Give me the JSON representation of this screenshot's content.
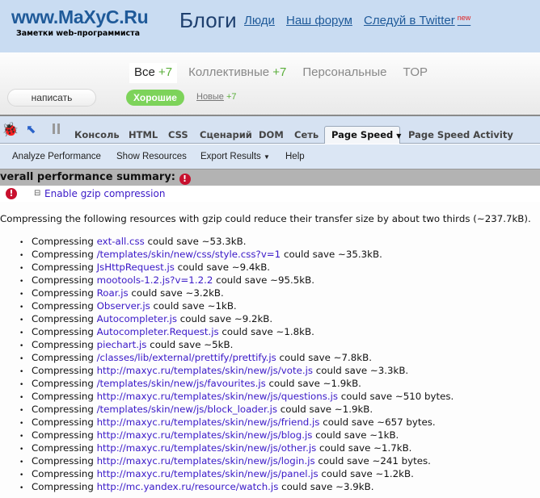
{
  "site": {
    "logo": "www.MaXyC.Ru",
    "tagline": "Заметки web-программиста",
    "section": "Блоги",
    "nav": [
      {
        "label": "Люди"
      },
      {
        "label": "Наш форум"
      },
      {
        "label": "Следуй в Twitter",
        "badge": "new"
      }
    ]
  },
  "tabs": [
    {
      "label": "Все",
      "count": "+7"
    },
    {
      "label": "Коллективные",
      "count": "+7"
    },
    {
      "label": "Персональные",
      "count": ""
    },
    {
      "label": "TOP",
      "count": ""
    }
  ],
  "write_button": "написать",
  "filters": {
    "good": "Хорошие",
    "new": "Новые",
    "new_count": "+7"
  },
  "firebug": {
    "tabs": [
      "Консоль",
      "HTML",
      "CSS",
      "Сценарий",
      "DOM",
      "Сеть",
      "Page Speed",
      "Page Speed Activity"
    ],
    "active_tab": "Page Speed",
    "toolbar": [
      "Analyze Performance",
      "Show Resources",
      "Export Results",
      "Help"
    ]
  },
  "summary": "verall performance summary:",
  "rule": "Enable gzip compression",
  "description": "Compressing the following resources with gzip could reduce their transfer size by about two thirds (~237.7kB).",
  "items": [
    {
      "pre": "Compressing ",
      "link": "ext-all.css",
      "post": " could save ~53.3kB."
    },
    {
      "pre": "Compressing ",
      "link": "/templates/skin/new/css/style.css?v=1",
      "post": " could save ~35.3kB."
    },
    {
      "pre": "Compressing ",
      "link": "JsHttpRequest.js",
      "post": " could save ~9.4kB."
    },
    {
      "pre": "Compressing ",
      "link": "mootools-1.2.js?v=1.2.2",
      "post": " could save ~95.5kB."
    },
    {
      "pre": "Compressing ",
      "link": "Roar.js",
      "post": " could save ~3.2kB."
    },
    {
      "pre": "Compressing ",
      "link": "Observer.js",
      "post": " could save ~1kB."
    },
    {
      "pre": "Compressing ",
      "link": "Autocompleter.js",
      "post": " could save ~9.2kB."
    },
    {
      "pre": "Compressing ",
      "link": "Autocompleter.Request.js",
      "post": " could save ~1.8kB."
    },
    {
      "pre": "Compressing ",
      "link": "piechart.js",
      "post": " could save ~5kB."
    },
    {
      "pre": "Compressing ",
      "link": "/classes/lib/external/prettify/prettify.js",
      "post": " could save ~7.8kB."
    },
    {
      "pre": "Compressing ",
      "link": "http://maxyc.ru/templates/skin/new/js/vote.js",
      "post": " could save ~3.3kB."
    },
    {
      "pre": "Compressing ",
      "link": "/templates/skin/new/js/favourites.js",
      "post": " could save ~1.9kB."
    },
    {
      "pre": "Compressing ",
      "link": "http://maxyc.ru/templates/skin/new/js/questions.js",
      "post": " could save ~510 bytes."
    },
    {
      "pre": "Compressing ",
      "link": "/templates/skin/new/js/block_loader.js",
      "post": " could save ~1.9kB."
    },
    {
      "pre": "Compressing ",
      "link": "http://maxyc.ru/templates/skin/new/js/friend.js",
      "post": " could save ~657 bytes."
    },
    {
      "pre": "Compressing ",
      "link": "http://maxyc.ru/templates/skin/new/js/blog.js",
      "post": " could save ~1kB."
    },
    {
      "pre": "Compressing ",
      "link": "http://maxyc.ru/templates/skin/new/js/other.js",
      "post": " could save ~1.7kB."
    },
    {
      "pre": "Compressing ",
      "link": "http://maxyc.ru/templates/skin/new/js/login.js",
      "post": " could save ~241 bytes."
    },
    {
      "pre": "Compressing ",
      "link": "http://maxyc.ru/templates/skin/new/js/panel.js",
      "post": " could save ~1.2kB."
    },
    {
      "pre": "Compressing ",
      "link": "http://mc.yandex.ru/resource/watch.js",
      "post": " could save ~3.9kB."
    }
  ]
}
